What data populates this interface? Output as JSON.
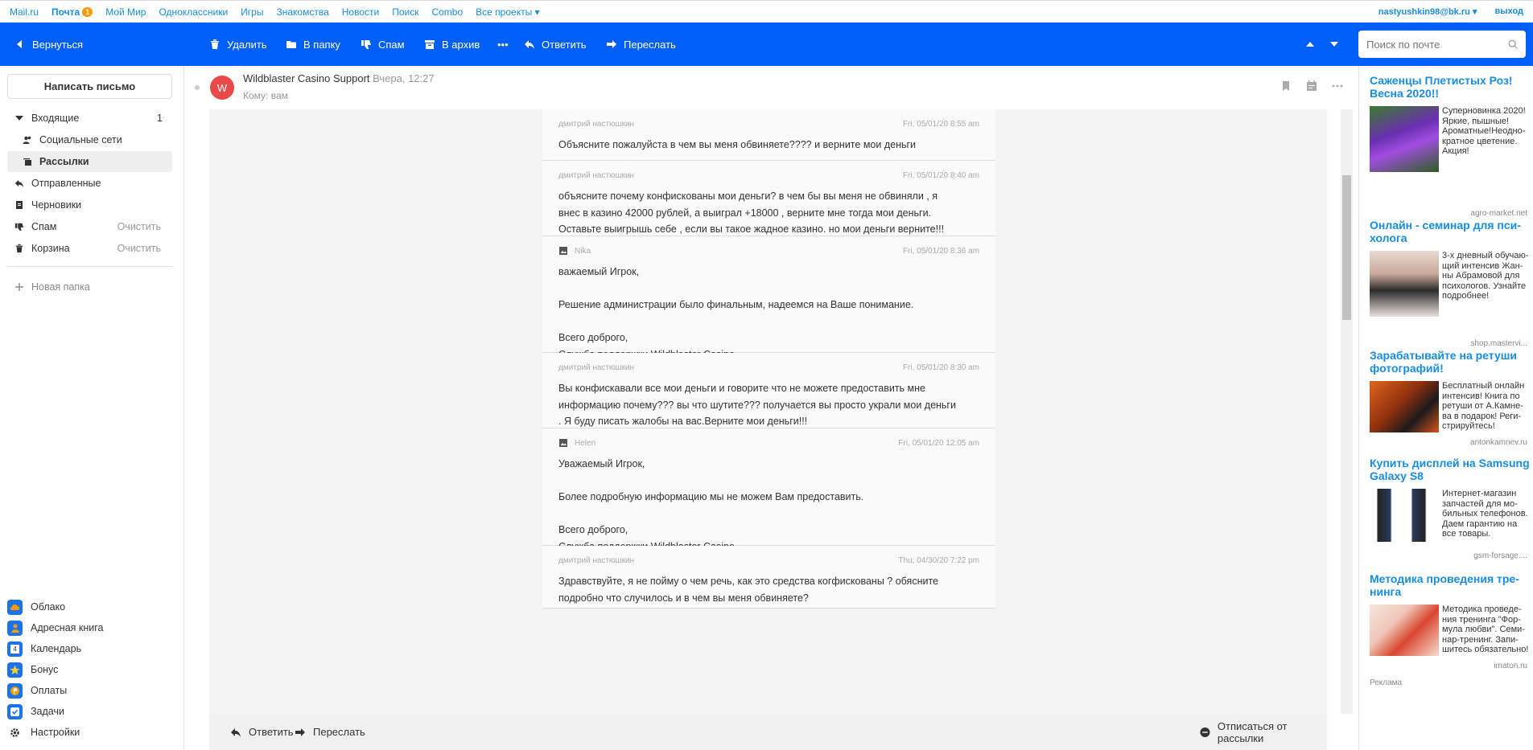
{
  "portal": {
    "links": [
      "Mail.ru",
      "Почта",
      "Мой Мир",
      "Одноклассники",
      "Игры",
      "Знакомства",
      "Новости",
      "Поиск",
      "Combo",
      "Все проекты ▾"
    ],
    "mail_badge": "1",
    "user_email": "nastyushkin98@bk.ru ▾",
    "logout": "выход"
  },
  "toolbar": {
    "back": "Вернуться",
    "delete": "Удалить",
    "to_folder": "В папку",
    "spam": "Спам",
    "archive": "В архив",
    "more": "•••",
    "reply": "Ответить",
    "forward": "Переслать",
    "search_placeholder": "Поиск по почте"
  },
  "sidebar": {
    "compose": "Написать письмо",
    "folders": [
      {
        "label": "Входящие",
        "count": "1"
      },
      {
        "label": "Социальные сети"
      },
      {
        "label": "Рассылки"
      },
      {
        "label": "Отправленные"
      },
      {
        "label": "Черновики"
      },
      {
        "label": "Спам",
        "action": "Очистить"
      },
      {
        "label": "Корзина",
        "action": "Очистить"
      }
    ],
    "new_folder": "Новая папка",
    "apps": [
      "Облако",
      "Адресная книга",
      "Календарь",
      "Бонус",
      "Оплаты",
      "Задачи"
    ],
    "settings": "Настройки"
  },
  "letter": {
    "avatar": "W",
    "sender": "Wildblaster Casino Support",
    "time": "Вчера, 12:27",
    "to": "Кому: вам",
    "messages": [
      {
        "from": "дмитрий настюшкин",
        "date": "Fri, 05/01/20 8:55 am",
        "text": "Объясните пожалуйста в чем вы меня обвиняете???? и верните мои деньги"
      },
      {
        "from": "дмитрий настюшкин",
        "date": "Fri, 05/01/20 8:40 am",
        "text": "объясните почему конфискованы мои деньги? в чем бы вы меня не обвиняли , я\nвнес в казино 42000 рублей, а выиграл +18000 , верните мне тогда мои деньги.\nОставьте выигрышь себе , если вы такое жадное казино. но мои деньги верните!!!"
      },
      {
        "from": "Nika",
        "date": "Fri, 05/01/20 8:36 am",
        "text": "важаемый Игрок,\n\nРешение администрации было финальным, надеемся на Ваше понимание.\n\nВсего доброго,\nСлужба поддержки Wildblaster Casino"
      },
      {
        "from": "дмитрий настюшкин",
        "date": "Fri, 05/01/20 8:30 am",
        "text": "Вы конфискавали все мои деньги и говорите что не можете предоставить мне\nинформацию почему??? вы что шутите??? получается вы просто украли мои деньги\n. Я буду писать жалобы на вас.Верните мои деньги!!!"
      },
      {
        "from": "Helen",
        "date": "Fri, 05/01/20 12:05 am",
        "text": "Уважаемый Игрок,\n\nБолее подробную информацию мы не можем Вам предоставить.\n\nВсего доброго,\nСлужба поддержки Wildblaster Casino"
      },
      {
        "from": "дмитрий настюшкин",
        "date": "Thu, 04/30/20 7:22 pm",
        "text": "Здравствуйте, я не пойму о чем речь, как это средства когфискованы ? обясните\nподробно что случилось и в чем вы меня обвиняете?"
      }
    ]
  },
  "footer": {
    "reply": "Ответить",
    "forward": "Переслать",
    "unsubscribe": "Отписаться от рассылки"
  },
  "ads": [
    {
      "title": "Саженцы Плетистых Роз! Весна 2020!!",
      "desc": "Суперновинка 2020! Яркие, пышные! Ароматные!Неодно-кратное цветение. Акция!",
      "source": "agro-market.net"
    },
    {
      "title": "Онлайн - семинар для пси-холога",
      "desc": "3-х дневный обучаю-щий интенсив Жан-ны Абрамовой для психологов. Узнайте подробнее!",
      "source": "shop.mastervi..."
    },
    {
      "title": "Зарабатывайте на ретуши фотографий!",
      "desc": "Бесплатный онлайн интенсив! Книга по ретуши от А.Камне-ва в подарок! Реги-стрируйтесь!",
      "source": "antonkamnev.ru"
    },
    {
      "title": "Купить дисплей на Samsung Galaxy S8",
      "desc": "Интернет-магазин запчастей для мо-бильных телефонов. Даем гарантию на все товары.",
      "source": "gsm-forsage...."
    },
    {
      "title": "Методика проведения тре-нинга",
      "desc": "Методика проведе-ния тренинга \"Фор-мула любви\". Семи-нар-тренинг. Запи-шитесь обязательно!",
      "source": "imaton.ru"
    }
  ],
  "ads_label": "Реклама",
  "colors": {
    "accent": "#005ff9",
    "link": "#168de2",
    "avatar": "#e94949",
    "badge": "#ff9900"
  }
}
